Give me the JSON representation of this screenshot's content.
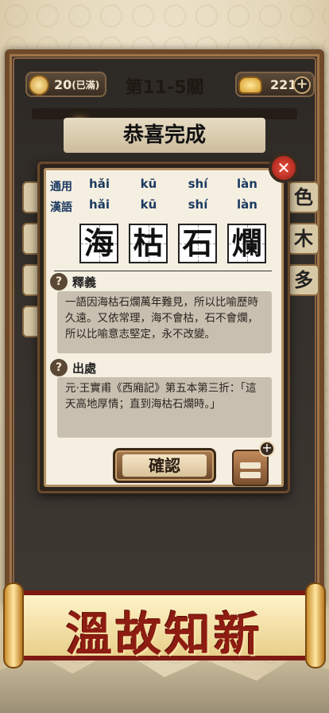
{
  "header": {
    "energy_value": "20",
    "energy_status": "(已滿)",
    "level_title": "第11-5關",
    "gold_value": "221",
    "add_symbol": "+"
  },
  "scene": {
    "congrats_title": "恭喜完成",
    "side_chars_right": [
      "色",
      "木",
      "多"
    ]
  },
  "dialog": {
    "pinyin_rows": [
      {
        "label": "通用",
        "syllables": [
          "hǎi",
          "kū",
          "shí",
          "làn"
        ]
      },
      {
        "label": "漢語",
        "syllables": [
          "hǎi",
          "kū",
          "shí",
          "làn"
        ]
      }
    ],
    "idiom_chars": [
      "海",
      "枯",
      "石",
      "爛"
    ],
    "meaning_title": "釋義",
    "meaning_text": "一語因海枯石爛萬年難見，所以比喻歷時久遠。又依常理，海不會枯，石不會爛，所以比喻意志堅定，永不改變。",
    "source_title": "出處",
    "source_text": "元·王實甫《西廂記》第五本第三折：「這天高地厚情；直到海枯石爛時。」",
    "confirm_label": "確認",
    "close_symbol": "✕",
    "book_plus": "+"
  },
  "banner": {
    "text": "溫故知新"
  },
  "colors": {
    "pinyin": "#1c3a62",
    "banner_text": "#8d1c12",
    "close_button": "#d63a2c"
  }
}
